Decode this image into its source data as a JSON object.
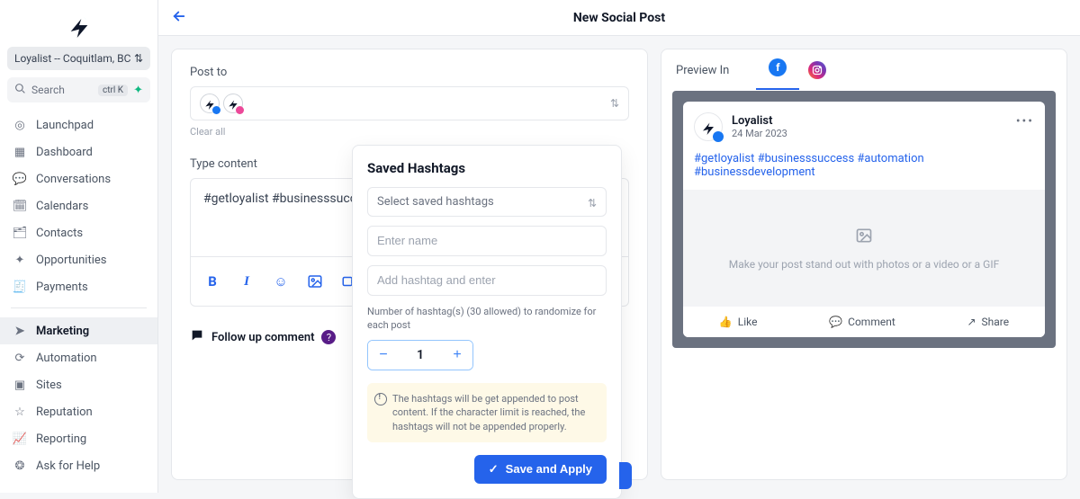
{
  "org": {
    "name": "Loyalist -- Coquitlam, BC"
  },
  "search": {
    "placeholder": "Search",
    "shortcut": "ctrl K"
  },
  "nav": {
    "items": [
      {
        "label": "Launchpad",
        "icon": "crosshair-icon"
      },
      {
        "label": "Dashboard",
        "icon": "grid-icon"
      },
      {
        "label": "Conversations",
        "icon": "chat-icon"
      },
      {
        "label": "Calendars",
        "icon": "calendar-icon"
      },
      {
        "label": "Contacts",
        "icon": "contacts-icon"
      },
      {
        "label": "Opportunities",
        "icon": "graph-icon"
      },
      {
        "label": "Payments",
        "icon": "receipt-icon"
      }
    ],
    "items2": [
      {
        "label": "Marketing",
        "icon": "send-icon",
        "active": true
      },
      {
        "label": "Automation",
        "icon": "sync-icon"
      },
      {
        "label": "Sites",
        "icon": "layout-icon"
      },
      {
        "label": "Reputation",
        "icon": "star-icon"
      },
      {
        "label": "Reporting",
        "icon": "trend-icon"
      },
      {
        "label": "Ask for Help",
        "icon": "lifebuoy-icon"
      }
    ]
  },
  "header": {
    "title": "New Social Post"
  },
  "editor": {
    "post_to_label": "Post to",
    "clear_all": "Clear all",
    "type_content_label": "Type content",
    "content_text": "#getloyalist #businesssucce",
    "followup_label": "Follow up comment"
  },
  "popover": {
    "title": "Saved Hashtags",
    "select_placeholder": "Select saved hashtags",
    "name_placeholder": "Enter name",
    "add_placeholder": "Add hashtag and enter",
    "randomize_hint": "Number of hashtag(s) (30 allowed) to randomize for each post",
    "count": "1",
    "alert_text": "The hashtags will be get appended to post content. If the character limit is reached, the hashtags will not be appended properly.",
    "apply_label": "Save and Apply"
  },
  "preview": {
    "label": "Preview In",
    "post_name": "Loyalist",
    "post_date": "24 Mar 2023",
    "post_tags": "#getloyalist #businesssuccess #automation #businessdevelopment",
    "media_hint": "Make your post stand out with photos or a video or a GIF",
    "like": "Like",
    "comment": "Comment",
    "share": "Share"
  }
}
